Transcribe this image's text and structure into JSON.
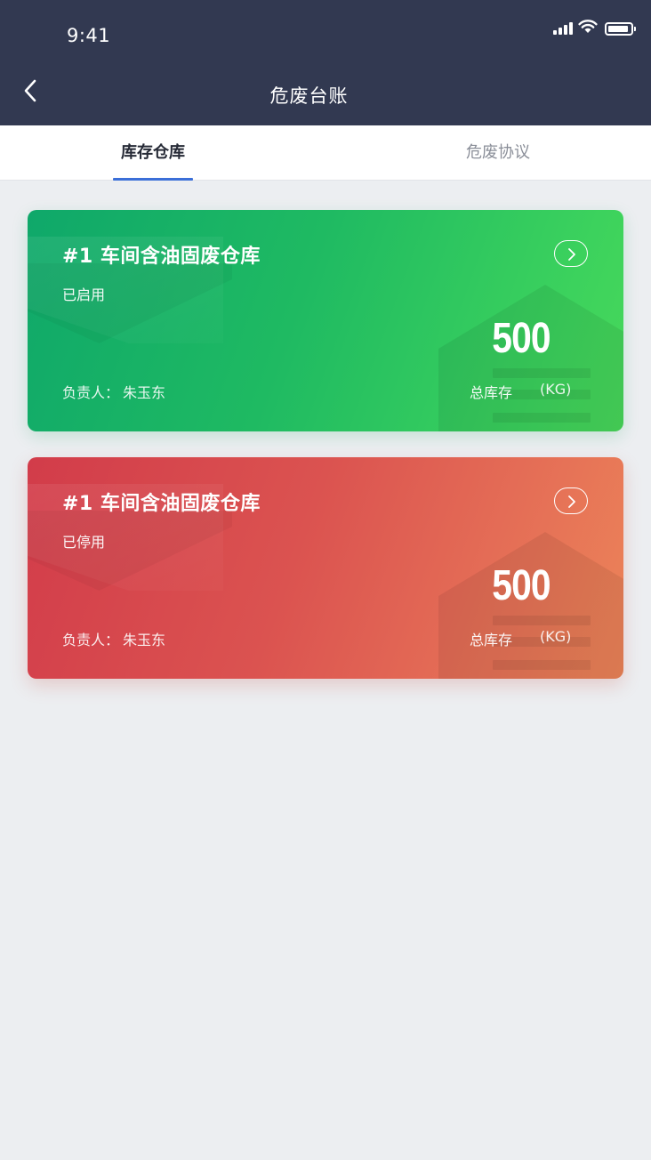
{
  "status_bar": {
    "time": "9:41"
  },
  "header": {
    "title": "危废台账"
  },
  "tabs": [
    {
      "label": "库存仓库",
      "active": true
    },
    {
      "label": "危废协议",
      "active": false
    }
  ],
  "cards": [
    {
      "title": "#1 车间含油固废仓库",
      "status": "已启用",
      "value": "500",
      "owner_label": "负责人：",
      "owner_name": "朱玉东",
      "total_label": "总库存",
      "unit": "(KG)",
      "color": "#1fba62"
    },
    {
      "title": "#1 车间含油固废仓库",
      "status": "已停用",
      "value": "500",
      "owner_label": "负责人：",
      "owner_name": "朱玉东",
      "total_label": "总库存",
      "unit": "(KG)",
      "color": "#db5350"
    }
  ],
  "colors": {
    "header_bg": "#323951",
    "tab_indicator": "#3b6fd8",
    "page_bg": "#eceef1"
  }
}
